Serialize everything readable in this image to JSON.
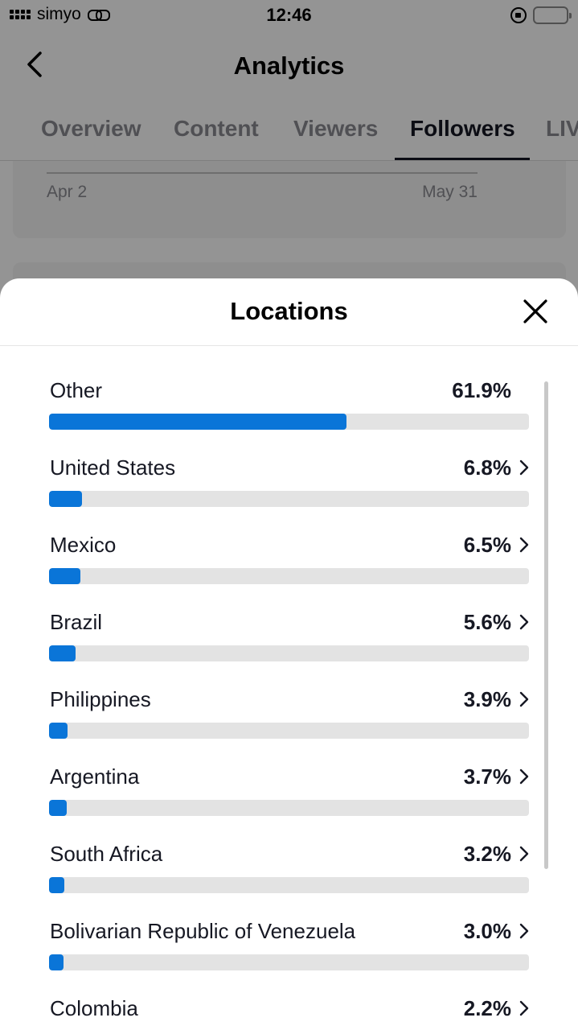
{
  "status_bar": {
    "carrier": "simyo",
    "time": "12:46"
  },
  "nav": {
    "title": "Analytics",
    "back_icon": "chevron-left-icon"
  },
  "tabs": [
    {
      "label": "Overview",
      "active": false
    },
    {
      "label": "Content",
      "active": false
    },
    {
      "label": "Viewers",
      "active": false
    },
    {
      "label": "Followers",
      "active": true
    },
    {
      "label": "LIVE",
      "active": false
    }
  ],
  "chart_card": {
    "date_start": "Apr 2",
    "date_end": "May 31"
  },
  "sheet": {
    "title": "Locations",
    "close_icon": "close-icon",
    "accent_color": "#0a75d8",
    "track_color": "#e3e3e3",
    "items": [
      {
        "name": "Other",
        "percent": "61.9%",
        "value": 61.9,
        "chevron": false
      },
      {
        "name": "United States",
        "percent": "6.8%",
        "value": 6.8,
        "chevron": true
      },
      {
        "name": "Mexico",
        "percent": "6.5%",
        "value": 6.5,
        "chevron": true
      },
      {
        "name": "Brazil",
        "percent": "5.6%",
        "value": 5.6,
        "chevron": true
      },
      {
        "name": "Philippines",
        "percent": "3.9%",
        "value": 3.9,
        "chevron": true
      },
      {
        "name": "Argentina",
        "percent": "3.7%",
        "value": 3.7,
        "chevron": true
      },
      {
        "name": "South Africa",
        "percent": "3.2%",
        "value": 3.2,
        "chevron": true
      },
      {
        "name": "Bolivarian Republic of Venezuela",
        "percent": "3.0%",
        "value": 3.0,
        "chevron": true
      },
      {
        "name": "Colombia",
        "percent": "2.2%",
        "value": 2.2,
        "chevron": true
      }
    ]
  }
}
